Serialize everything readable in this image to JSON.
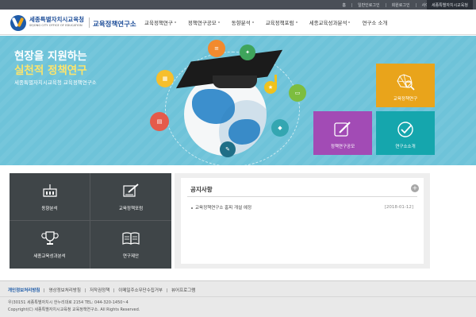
{
  "utility_links": [
    "홈",
    "일반인로그인",
    "회원로그인",
    "사이트맵"
  ],
  "site_button_label": "세종특별자치시교육청",
  "org": {
    "name": "세종특별자치시교육청",
    "english": "SEJONG CITY OFFICE OF EDUCATION",
    "institute": "교육정책연구소"
  },
  "nav": {
    "items": [
      "교육정책연구",
      "정책연구공모",
      "동향분석",
      "교육정책포럼",
      "세종교육성과분석",
      "연구소 소개"
    ]
  },
  "hero": {
    "line1": "현장을 지원하는",
    "line2": "실천적 정책연구",
    "subtitle": "세종특별자치시교육청 교육정책연구소",
    "tiles": {
      "research": "교육정책연구",
      "contest": "정책연구공모",
      "intro": "연구소소개"
    },
    "accent_color": "#fbe46d",
    "background_color": "#6ec3d9"
  },
  "quick_menu": {
    "trend": "동향분석",
    "forum": "교육정책포럼",
    "outcome": "세종교육성과분석",
    "proposal": "연구제안"
  },
  "notice": {
    "title": "공지사항",
    "more_label": "+",
    "items": [
      {
        "title": "교육정책연구소 홈피 개설 예정",
        "date": "[2018-01-12]"
      }
    ]
  },
  "footer": {
    "links": [
      "개인정보처리방침",
      "영상정보처리방침",
      "저작권정책",
      "이메일주소무단수집거부",
      "뷰어프로그램"
    ],
    "address": "우)30151 세종특별자치시 한누리대로 2154  TEL: 044-320-1450~4",
    "copyright": "Copyright(C) 세종특별자치시교육청 교육정책연구소. All Rights Reserved."
  }
}
